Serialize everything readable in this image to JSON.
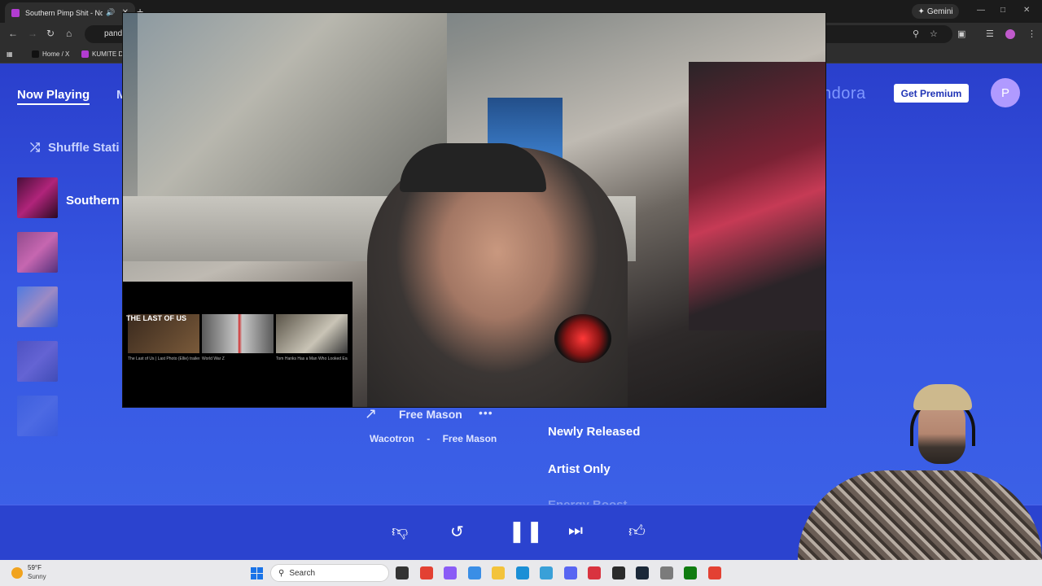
{
  "browser": {
    "tab_title": "Southern Pimp Shit - Now Playing",
    "gemini_label": "Gemini",
    "omnibox_text": "pandora.com",
    "bookmarks": [
      {
        "label": "Home / X",
        "color": "#111111"
      },
      {
        "label": "KUMITE D",
        "color": "#b23cd1"
      }
    ]
  },
  "pandora": {
    "nav_now_playing": "Now Playing",
    "nav_my": "M",
    "logo": "ndora",
    "premium_label": "Get Premium",
    "avatar_letter": "P",
    "shuffle_label": "Shuffle Stati",
    "station_name": "Southern",
    "song_title": "Free Mason",
    "song_artist": "Wacotron",
    "song_separator": "-",
    "song_album": "Free Mason",
    "modes": [
      "Newly Released",
      "Artist Only",
      "Energy Boost"
    ],
    "accent_color": "#3656e2"
  },
  "video": {
    "thumb_label": "THE LAST OF US",
    "thumbs": [
      {
        "caption": "The Last of Us | Last Photo (Ellie) trailer"
      },
      {
        "caption": "World War Z"
      },
      {
        "caption": "Tom Hanks Has a Man Who Looked Exactly Like Him"
      }
    ]
  },
  "taskbar": {
    "temp": "59°F",
    "weather": "Sunny",
    "search_placeholder": "Search",
    "apps": [
      {
        "name": "task-view",
        "color": "#333333"
      },
      {
        "name": "chrome",
        "color": "#e34133"
      },
      {
        "name": "copilot",
        "color": "#8a5cf6"
      },
      {
        "name": "photos",
        "color": "#3a8ee6"
      },
      {
        "name": "file-explorer",
        "color": "#f3c33b"
      },
      {
        "name": "edge",
        "color": "#1a8fd6"
      },
      {
        "name": "notepad",
        "color": "#39a0d8"
      },
      {
        "name": "discord",
        "color": "#5865f2"
      },
      {
        "name": "snipping-tool",
        "color": "#d9333f"
      },
      {
        "name": "obs",
        "color": "#2b2b2b"
      },
      {
        "name": "steam",
        "color": "#1b2838"
      },
      {
        "name": "game",
        "color": "#7b7b7b"
      },
      {
        "name": "xbox",
        "color": "#107c10"
      },
      {
        "name": "chrome-2",
        "color": "#e34133"
      }
    ]
  }
}
